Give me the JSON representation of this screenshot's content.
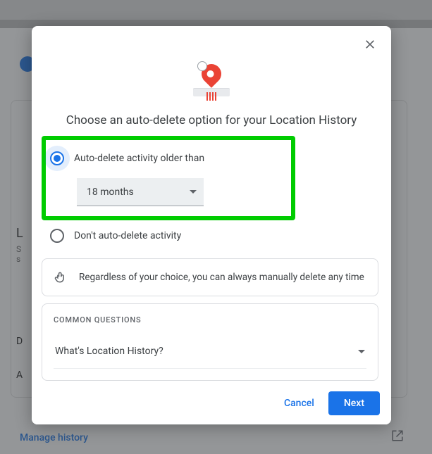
{
  "bg": {
    "manage_link": "Manage history",
    "L": "L",
    "S": "S",
    "s2": "s",
    "D": "D",
    "A": "A"
  },
  "dialog": {
    "title": "Choose an auto-delete option for your Location History",
    "option_auto_label": "Auto-delete activity older than",
    "dropdown_value": "18 months",
    "option_noauto_label": "Don't auto-delete activity",
    "info_text": "Regardless of your choice, you can always manually delete any time",
    "cq_title": "COMMON QUESTIONS",
    "cq_item1": "What's Location History?",
    "cancel": "Cancel",
    "next": "Next"
  }
}
